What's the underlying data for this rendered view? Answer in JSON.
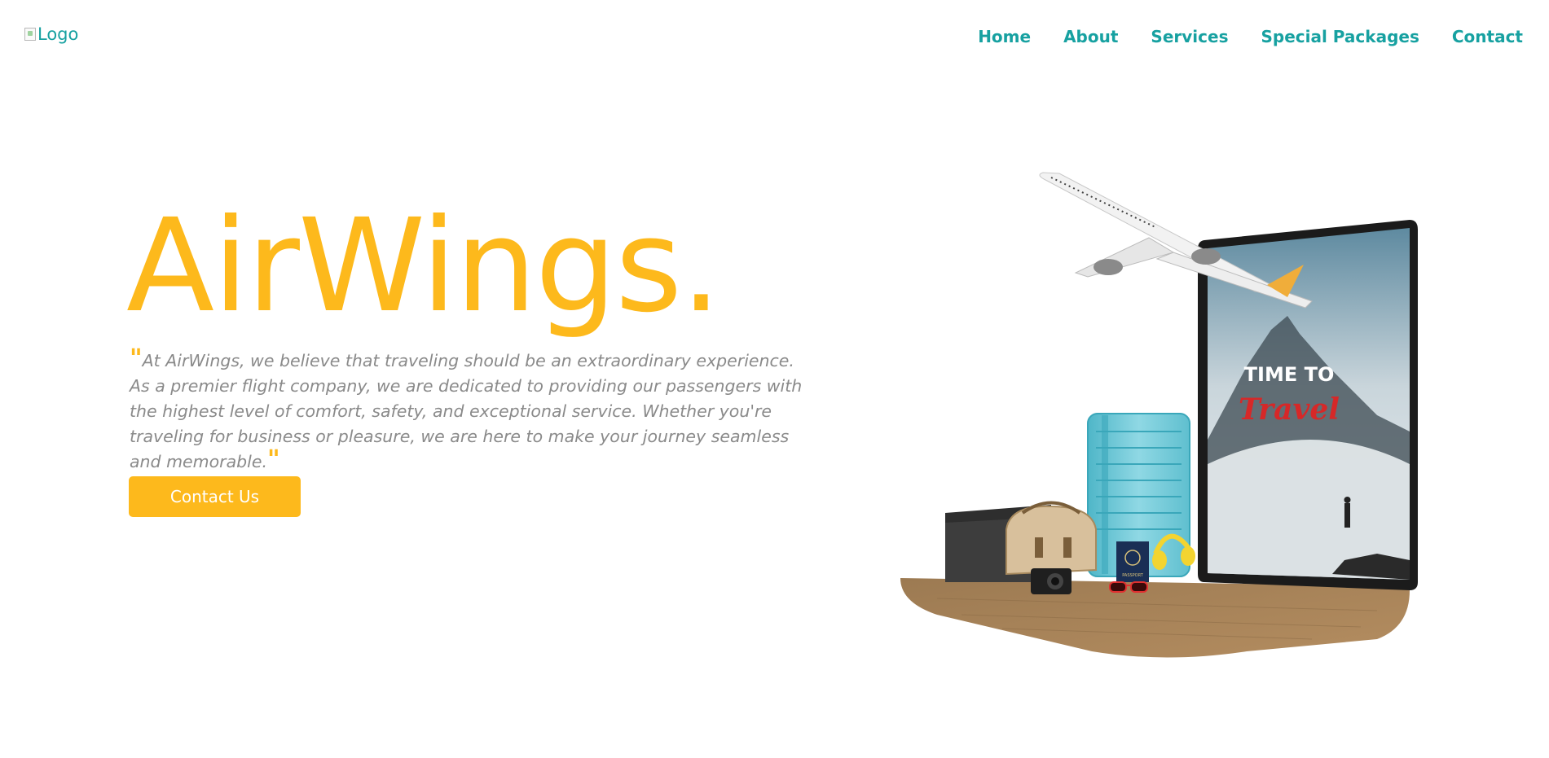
{
  "header": {
    "logo_alt": "Logo",
    "nav": [
      "Home",
      "About",
      "Services",
      "Special Packages",
      "Contact"
    ]
  },
  "hero": {
    "title": "AirWings.",
    "description": "At AirWings, we believe that traveling should be an extraordinary experience. As a premier flight company, we are dedicated to providing our passengers with the highest level of comfort, safety, and exceptional service. Whether you're traveling for business or pleasure, we are here to make your journey seamless and memorable.",
    "quote_open": "\"",
    "quote_close": "\"",
    "cta_label": "Contact Us"
  },
  "illustration": {
    "screen_line1": "TIME TO",
    "screen_line2": "Travel",
    "passport_label": "PASSPORT"
  },
  "colors": {
    "accent": "#fdb91c",
    "nav": "#17a1a1",
    "body_text": "#8a8a8a"
  }
}
